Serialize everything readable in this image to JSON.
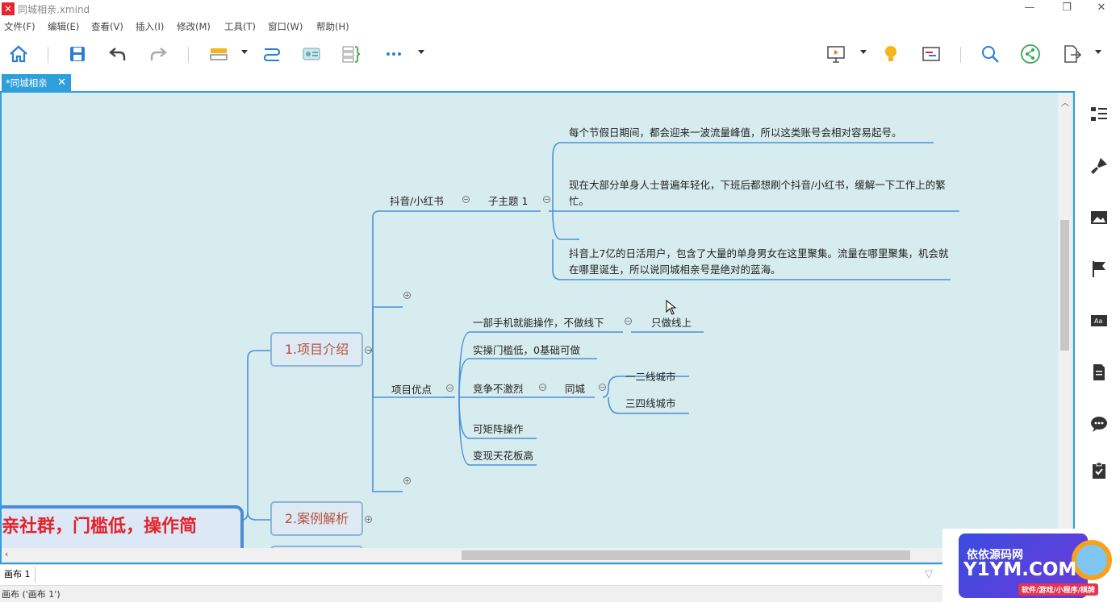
{
  "window": {
    "title": "同城相亲.xmind",
    "minimize": "—",
    "restore": "❐",
    "close": "✕"
  },
  "menu": [
    "文件(F)",
    "编辑(E)",
    "查看(V)",
    "插入(I)",
    "修改(M)",
    "工具(T)",
    "窗口(W)",
    "帮助(H)"
  ],
  "tab": {
    "label": "*同城相亲",
    "close": "✕"
  },
  "colors": {
    "accent": "#2f9fdc",
    "canvas": "#d7ecee",
    "line": "#4a90d9",
    "topic_text": "#b5523a",
    "central_text": "#e4222a"
  },
  "mindmap": {
    "central": "亲社群，门槛低，操作简",
    "main_topics": [
      "1.项目介绍",
      "2.案例解析"
    ],
    "douyin": "抖音/小红书",
    "subtopic1": "子主题 1",
    "notes": [
      "每个节假日期间，都会迎来一波流量峰值，所以这类账号会相对容易起号。",
      "现在大部分单身人士普遍年轻化，下班后都想刷个抖音/小红书，缓解一下工作上的繁忙。",
      "抖音上7亿的日活用户，包含了大量的单身男女在这里聚集。流量在哪里聚集，机会就在哪里诞生，所以说同城相亲号是绝对的蓝海。"
    ],
    "advantages": "项目优点",
    "adv_items": [
      "一部手机就能操作，不做线下",
      "实操门槛低，0基础可做",
      "竞争不激烈",
      "可矩阵操作",
      "变现天花板高"
    ],
    "offline_only": "只做线上",
    "same_city": "同城",
    "cities": [
      "一二线城市",
      "三四线城市"
    ]
  },
  "sheet": {
    "tab": "画布 1",
    "status": "画布 ('画布 1')"
  },
  "watermark": {
    "line1": "依依源码网",
    "line2": "Y1YM.COM",
    "line3": "软件/游戏/小程序/棋牌"
  },
  "toolbar_icons": [
    "home-icon",
    "save-icon",
    "undo-icon",
    "redo-icon",
    "topic-style-icon",
    "relationship-icon",
    "boundary-icon",
    "summary-icon",
    "more-icon",
    "presentation-icon",
    "idea-icon",
    "gantt-icon",
    "search-icon",
    "share-icon",
    "export-icon"
  ],
  "panel_icons": [
    "outline-icon",
    "format-icon",
    "image-icon",
    "marker-icon",
    "textbox-icon",
    "notes-icon",
    "comment-icon",
    "task-icon"
  ]
}
